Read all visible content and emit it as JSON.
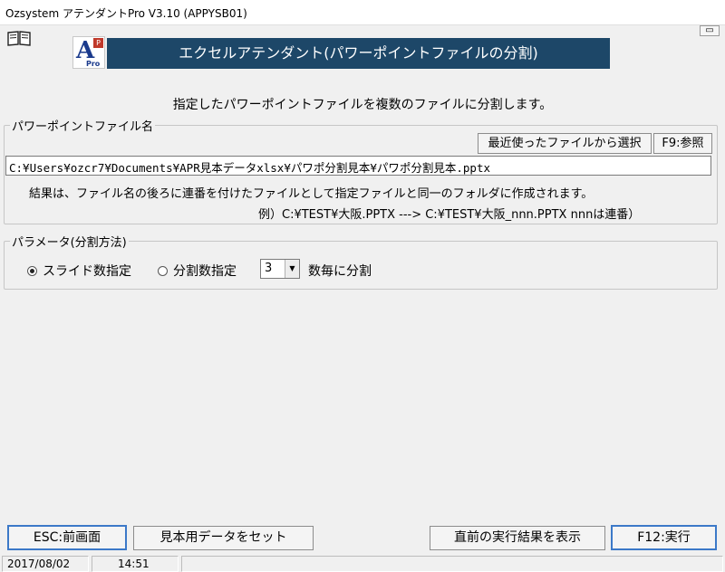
{
  "window": {
    "title": "Ozsystem アテンダントPro V3.10 (APPYSB01)",
    "restore_glyph": "▭"
  },
  "logo": {
    "letter": "A",
    "badge": "P",
    "sub": "Pro"
  },
  "banner": {
    "title": "エクセルアテンダント(パワーポイントファイルの分割)"
  },
  "description": "指定したパワーポイントファイルを複数のファイルに分割します。",
  "file_group": {
    "label": "パワーポイントファイル名",
    "recent_button": "最近使ったファイルから選択",
    "browse_button": "F9:参照",
    "path_value": "C:¥Users¥ozcr7¥Documents¥APR見本データxlsx¥パワポ分割見本¥パワポ分割見本.pptx",
    "note1": "結果は、ファイル名の後ろに連番を付けたファイルとして指定ファイルと同一のフォルダに作成されます。",
    "note2": "例）C:¥TEST¥大阪.PPTX ---> C:¥TEST¥大阪_nnn.PPTX  nnnは連番）"
  },
  "params_group": {
    "label": "パラメータ(分割方法)",
    "radio_slide": "スライド数指定",
    "radio_split": "分割数指定",
    "selected": "slide",
    "count_value": "3",
    "suffix": "数毎に分割"
  },
  "buttons": {
    "esc": "ESC:前画面",
    "sample": "見本用データをセット",
    "last_result": "直前の実行結果を表示",
    "execute": "F12:実行"
  },
  "status": {
    "date": "2017/08/02",
    "time": "14:51"
  }
}
